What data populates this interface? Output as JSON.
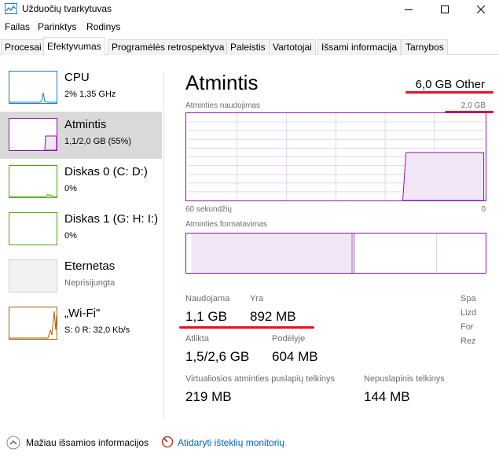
{
  "window": {
    "title": "Užduočių tvarkytuvas"
  },
  "menu": [
    "Failas",
    "Parinktys",
    "Rodinys"
  ],
  "tabs": [
    {
      "label": "Procesai",
      "active": false
    },
    {
      "label": "Efektyvumas",
      "active": true
    },
    {
      "label": "Programėlės retrospektyva",
      "active": false
    },
    {
      "label": "Paleistis",
      "active": false
    },
    {
      "label": "Vartotojai",
      "active": false
    },
    {
      "label": "Išsami informacija",
      "active": false
    },
    {
      "label": "Tarnybos",
      "active": false
    }
  ],
  "sidebar": [
    {
      "name": "CPU",
      "sub": "2% 1,35 GHz",
      "color": "#1a7bc7",
      "selected": false
    },
    {
      "name": "Atmintis",
      "sub": "1,1/2,0 GB (55%)",
      "color": "#8b12ae",
      "selected": true
    },
    {
      "name": "Diskas 0 (C: D:)",
      "sub": "0%",
      "color": "#4da60c",
      "selected": false
    },
    {
      "name": "Diskas 1 (G: H: I:)",
      "sub": "0%",
      "color": "#4da60c",
      "selected": false
    },
    {
      "name": "Eternetas",
      "sub": "Neprisijungta",
      "color": "#d0d0d0",
      "selected": false
    },
    {
      "name": "„Wi-Fi\"",
      "sub": "S: 0 R: 32,0 Kb/s",
      "color": "#a75e00",
      "selected": false
    }
  ],
  "main": {
    "title": "Atmintis",
    "total": "6,0 GB Other",
    "usage_label": "Atminties naudojimas",
    "usage_max": "2,0 GB",
    "time_left": "60 sekundžių",
    "time_right": "0",
    "composition_label": "Atminties formatavimas",
    "usage_fill_fraction": 0.55,
    "stats": {
      "in_use_label": "Naudojama",
      "in_use_value": "1,1 GB",
      "available_label": "Yra",
      "available_value": "892 MB",
      "committed_label": "Atlikta",
      "committed_value": "1,5/2,6 GB",
      "cached_label": "Podėlyje",
      "cached_value": "604 MB",
      "paged_label": "Virtualiosios atminties puslapių telkinys",
      "paged_value": "219 MB",
      "nonpaged_label": "Nepuslapinis telkinys",
      "nonpaged_value": "144 MB"
    },
    "side_stats": [
      "Spa",
      "Lizd",
      "For",
      "Rez"
    ]
  },
  "footer": {
    "fewer_details": "Mažiau išsamios informacijos",
    "open_monitor": "Atidaryti išteklių monitorių"
  },
  "colors": {
    "accent": "#8b12ae",
    "annotation_red": "#e81123",
    "link": "#0063b1"
  }
}
